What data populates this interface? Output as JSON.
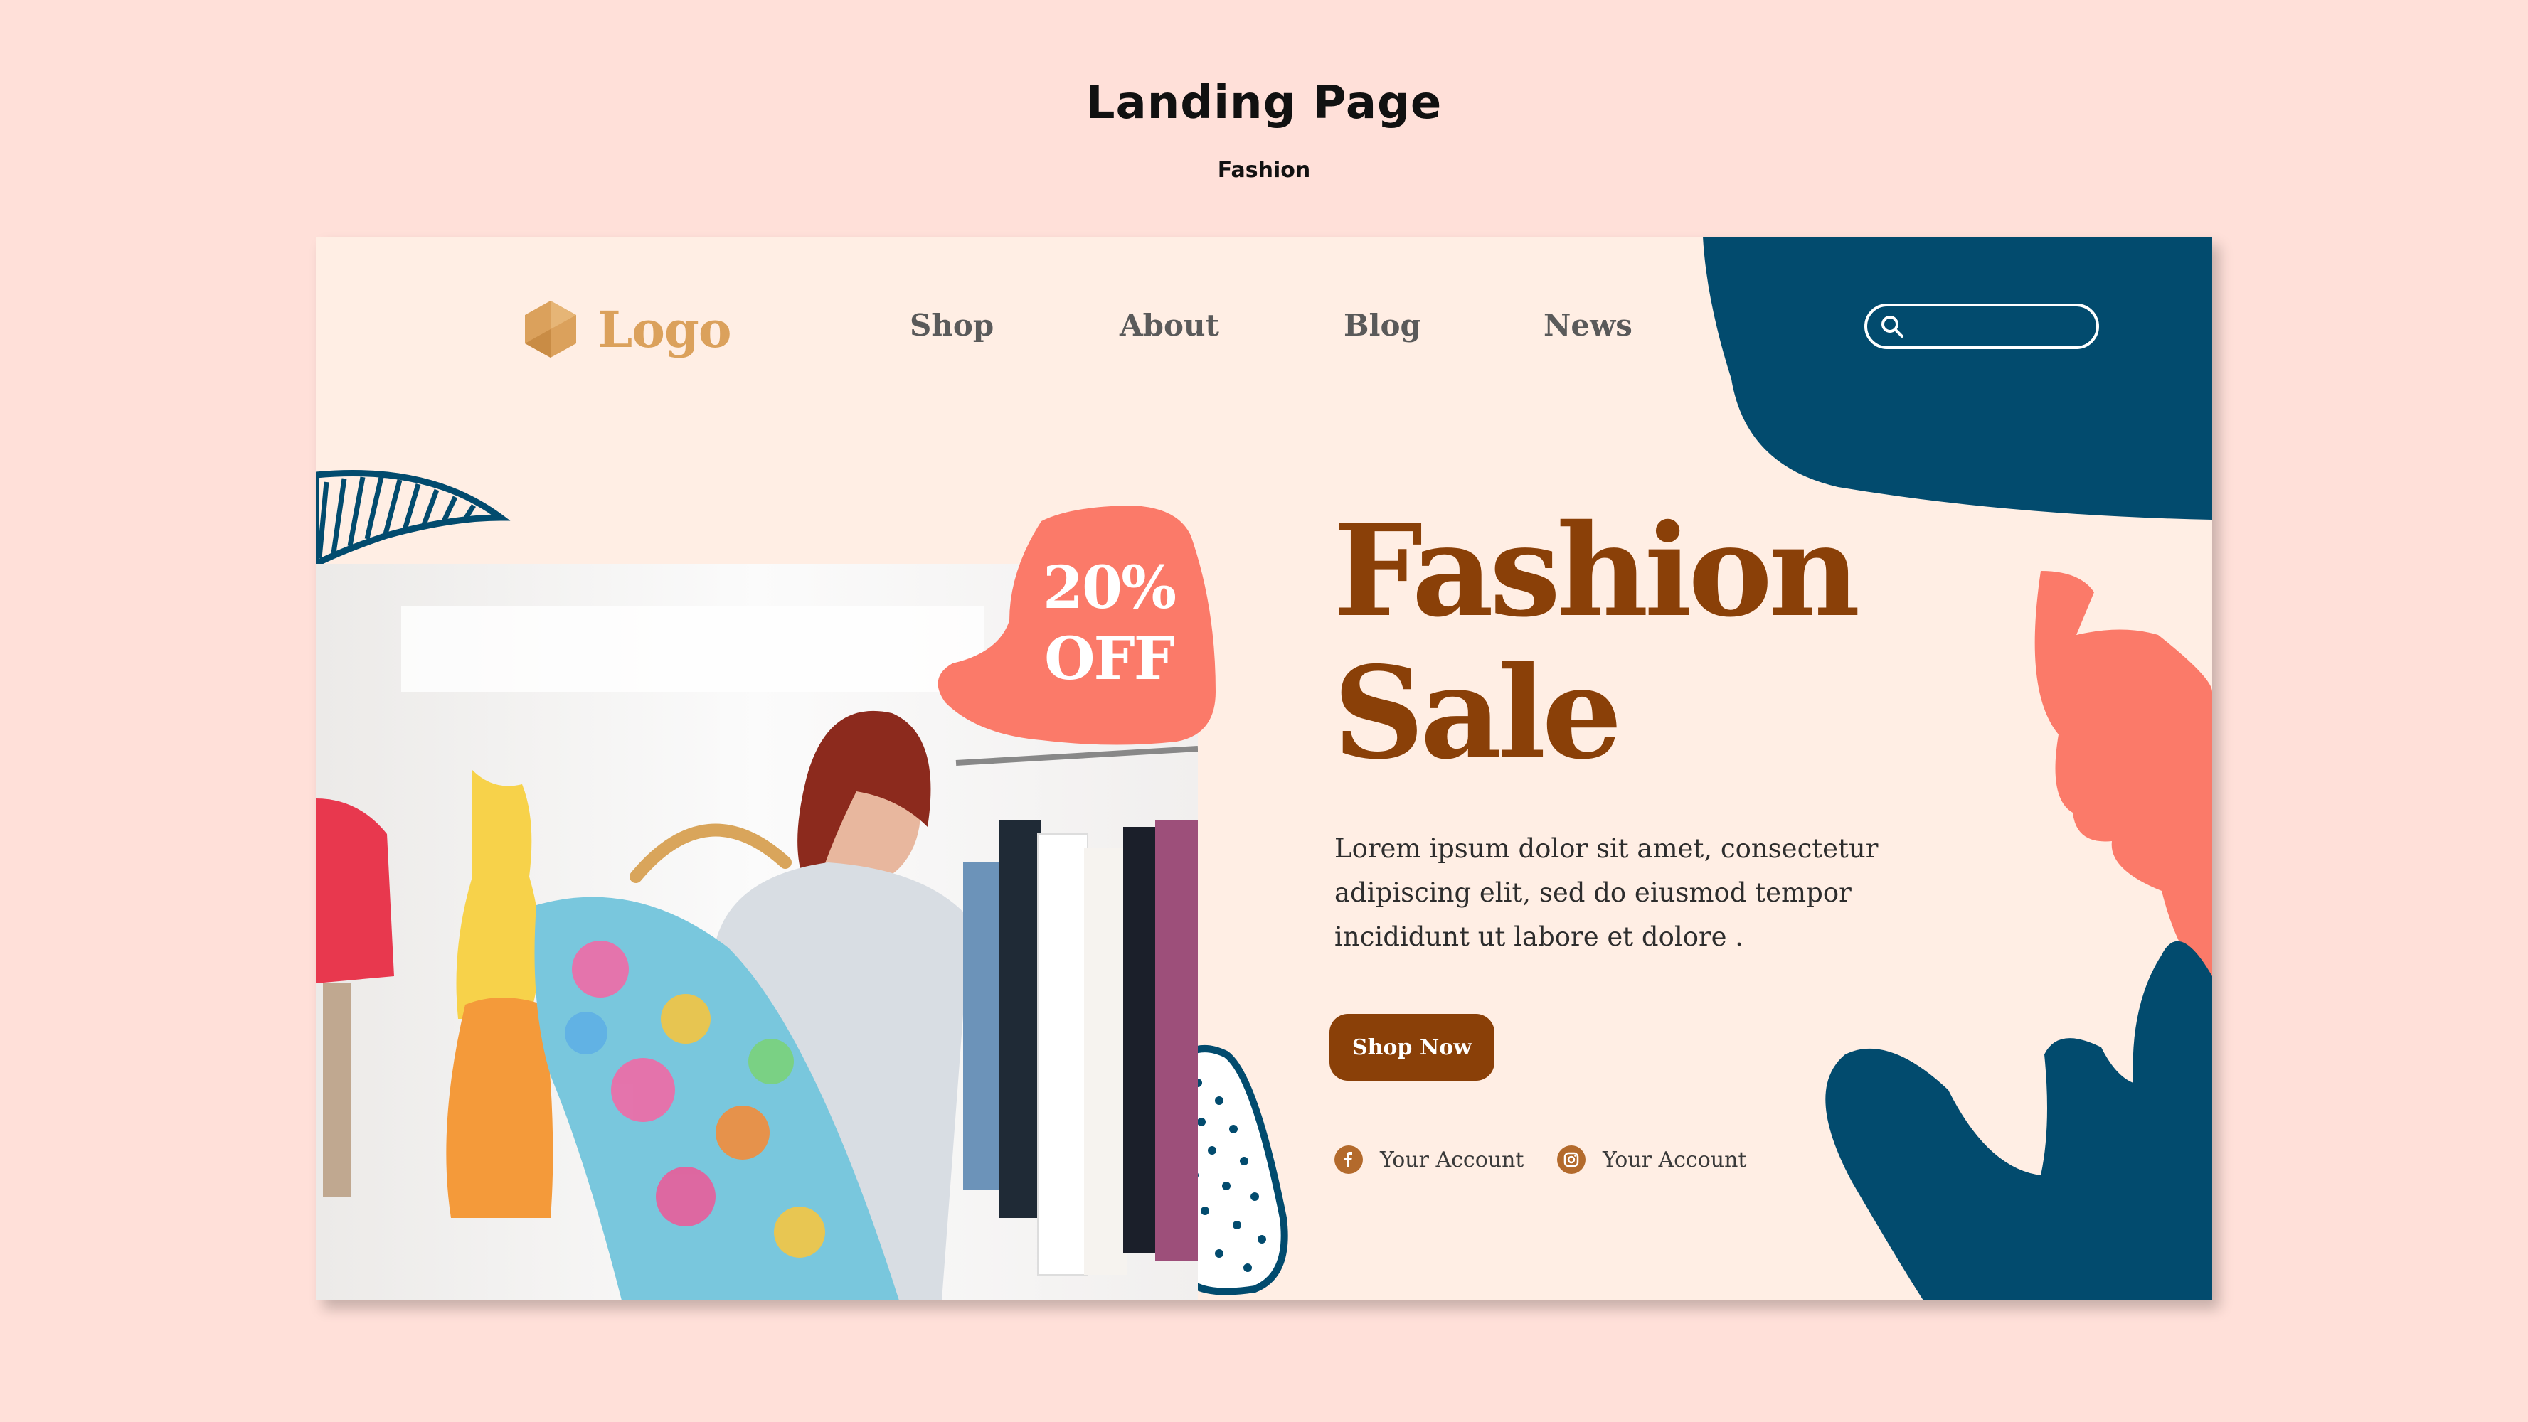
{
  "page": {
    "title": "Landing Page",
    "subtitle": "Fashion"
  },
  "brand": {
    "logo_text": "Logo",
    "logo_icon": "hexagon-icon",
    "color": "#dba15c"
  },
  "nav": {
    "items": [
      {
        "label": "Shop"
      },
      {
        "label": "About"
      },
      {
        "label": "Blog"
      },
      {
        "label": "News"
      }
    ]
  },
  "search": {
    "icon": "search-icon",
    "placeholder": ""
  },
  "promo": {
    "discount": "20%",
    "off": "OFF",
    "color": "#fb7a69"
  },
  "hero": {
    "title_line1": "Fashion",
    "title_line2": "Sale",
    "description": "Lorem ipsum dolor sit amet, consectetur adipiscing elit, sed do eiusmod tempor incididunt ut labore et dolore .",
    "cta_label": "Shop Now",
    "accent_color": "#8a4008"
  },
  "social": [
    {
      "icon": "facebook-icon",
      "label": "Your Account"
    },
    {
      "icon": "instagram-icon",
      "label": "Your Account"
    }
  ],
  "colors": {
    "background": "#ffe0d9",
    "card": "#ffeee4",
    "navy": "#024b6e",
    "coral": "#fb7a69",
    "brown": "#8a4008"
  }
}
